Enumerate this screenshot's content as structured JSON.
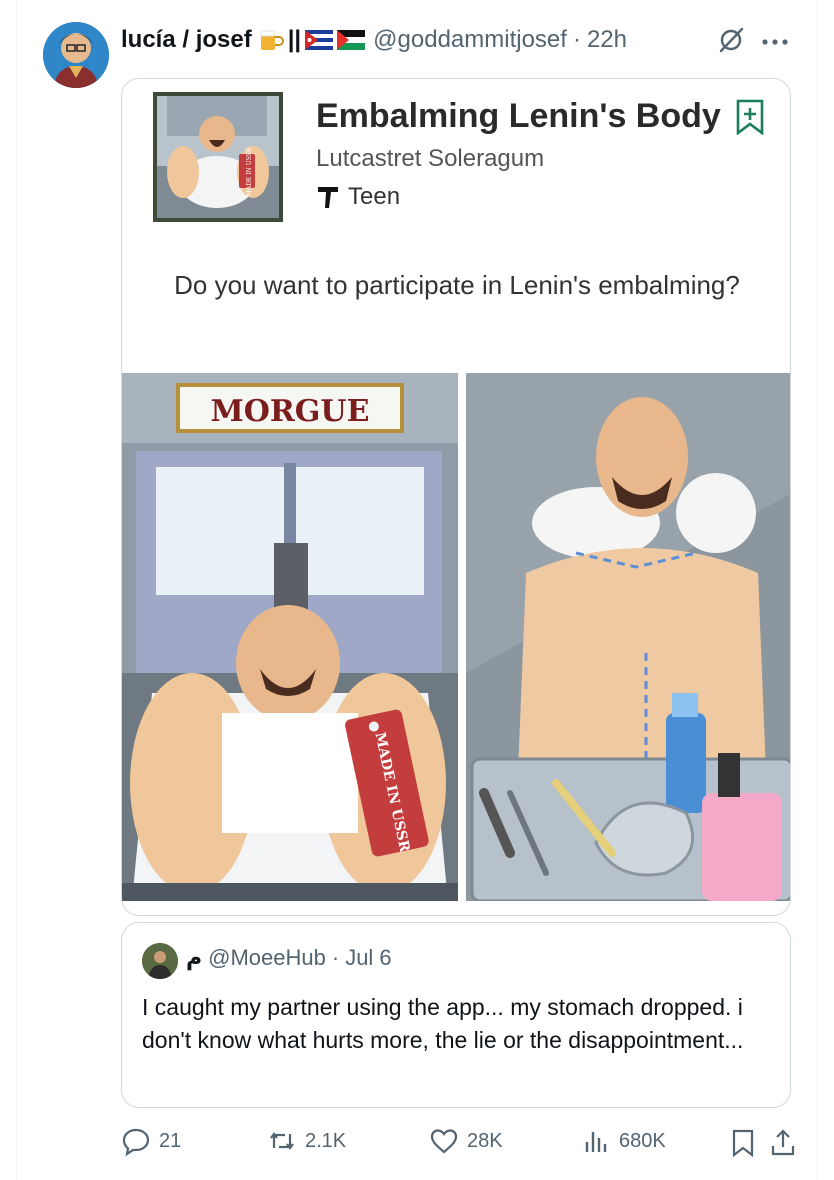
{
  "tweet": {
    "display_name": "lucía / josef",
    "name_suffix": "||",
    "handle": "@goddammitjosef",
    "separator": "·",
    "time": "22h"
  },
  "card": {
    "app_title": "Embalming Lenin's Body",
    "developer": "Lutcastret Soleragum",
    "rating": "Teen",
    "question": "Do you want to participate in Lenin's embalming?",
    "morgue_sign": "MORGUE",
    "tag_text": "MADE IN USSR",
    "thumb_tag_text": "MADE IN USSR"
  },
  "quote": {
    "name": "م",
    "handle": "@MoeeHub",
    "separator": "·",
    "date": "Jul 6",
    "text": "I caught my partner using the app... my stomach dropped. i don't know what hurts more, the lie or the disappointment..."
  },
  "actions": {
    "replies": "21",
    "reposts": "2.1K",
    "likes": "28K",
    "views": "680K"
  },
  "colors": {
    "text_primary": "#0f1419",
    "text_secondary": "#536471",
    "border": "#cfd9de",
    "tag_red": "#c43d3d",
    "skin": "#f0c79a"
  },
  "icons": [
    "beer-mug-icon",
    "cuba-flag-icon",
    "palestine-flag-icon",
    "grok-icon",
    "more-icon",
    "bookmark-plus-icon",
    "teen-rating-icon",
    "reply-icon",
    "repost-icon",
    "like-icon",
    "views-icon",
    "bookmark-icon",
    "share-icon"
  ]
}
